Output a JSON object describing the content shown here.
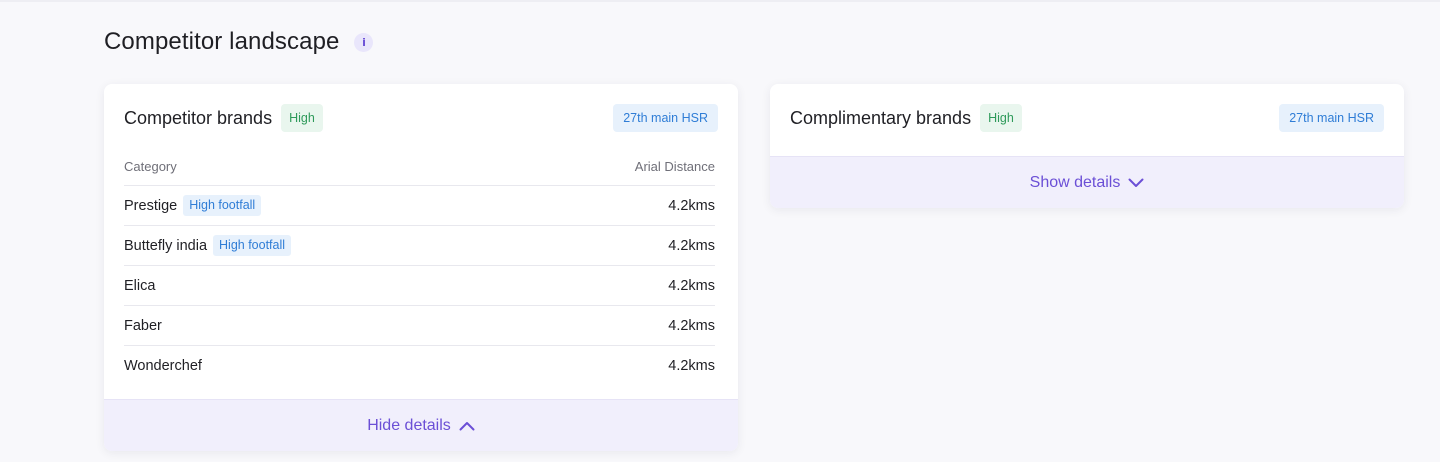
{
  "section": {
    "title": "Competitor landscape",
    "info_icon": "i"
  },
  "competitor_card": {
    "title": "Competitor brands",
    "level_badge": "High",
    "location_badge": "27th main HSR",
    "columns": [
      "Category",
      "Arial Distance"
    ],
    "rows": [
      {
        "name": "Prestige",
        "tag": "High footfall",
        "distance": "4.2kms"
      },
      {
        "name": "Buttefly india",
        "tag": "High footfall",
        "distance": "4.2kms"
      },
      {
        "name": "Elica",
        "tag": "",
        "distance": "4.2kms"
      },
      {
        "name": "Faber",
        "tag": "",
        "distance": "4.2kms"
      },
      {
        "name": "Wonderchef",
        "tag": "",
        "distance": "4.2kms"
      }
    ],
    "toggle_label": "Hide details",
    "toggle_icon": "chevron-up-icon"
  },
  "complimentary_card": {
    "title": "Complimentary brands",
    "level_badge": "High",
    "location_badge": "27th main HSR",
    "toggle_label": "Show details",
    "toggle_icon": "chevron-down-icon"
  },
  "colors": {
    "accent": "#6b4fd6",
    "high_badge_bg": "#e9f6ee",
    "high_badge_text": "#2e9a5a",
    "location_badge_bg": "#e7f1fc",
    "location_badge_text": "#2f7dd6"
  }
}
